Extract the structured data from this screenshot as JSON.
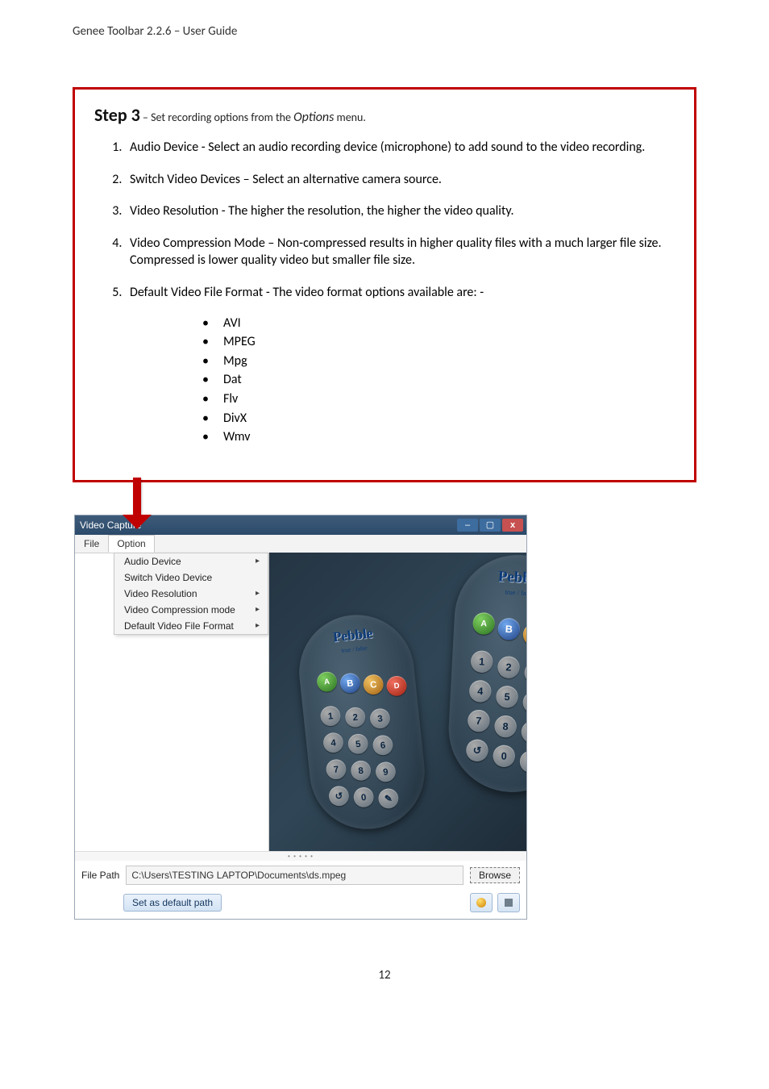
{
  "header": "Genee Toolbar 2.2.6 – User Guide",
  "step": {
    "title_bold": "Step 3",
    "title_rest_1": " – Set recording options from the ",
    "title_italic": "Options",
    "title_rest_2": " menu.",
    "items": [
      "Audio Device - Select an audio recording device (microphone) to add sound to the video recording.",
      "Switch Video Devices – Select an alternative camera source.",
      "Video Resolution - The higher the resolution, the higher the video quality.",
      "Video Compression Mode – Non-compressed results in higher quality files with a much larger file size.  Compressed is lower quality video but smaller file size.",
      "Default Video File Format -  The video format options available are: -"
    ],
    "formats": [
      "AVI",
      "MPEG",
      "Mpg",
      "Dat",
      "Flv",
      "DivX",
      "Wmv"
    ]
  },
  "screenshot": {
    "title": "Video Capture",
    "win_close": "x",
    "menus": {
      "file": "File",
      "option": "Option"
    },
    "dropdown": [
      {
        "label": "Audio Device",
        "hasArrow": true
      },
      {
        "label": "Switch Video Device",
        "hasArrow": false
      },
      {
        "label": "Video Resolution",
        "hasArrow": true
      },
      {
        "label": "Video Compression mode",
        "hasArrow": true
      },
      {
        "label": "Default Video File Format",
        "hasArrow": true
      }
    ],
    "remote_brand": "Pebble",
    "footer": {
      "filepath_label": "File Path",
      "filepath_value": "C:\\Users\\TESTING LAPTOP\\Documents\\ds.mpeg",
      "browse": "Browse",
      "set_default": "Set as default path"
    }
  },
  "page_number": "12"
}
